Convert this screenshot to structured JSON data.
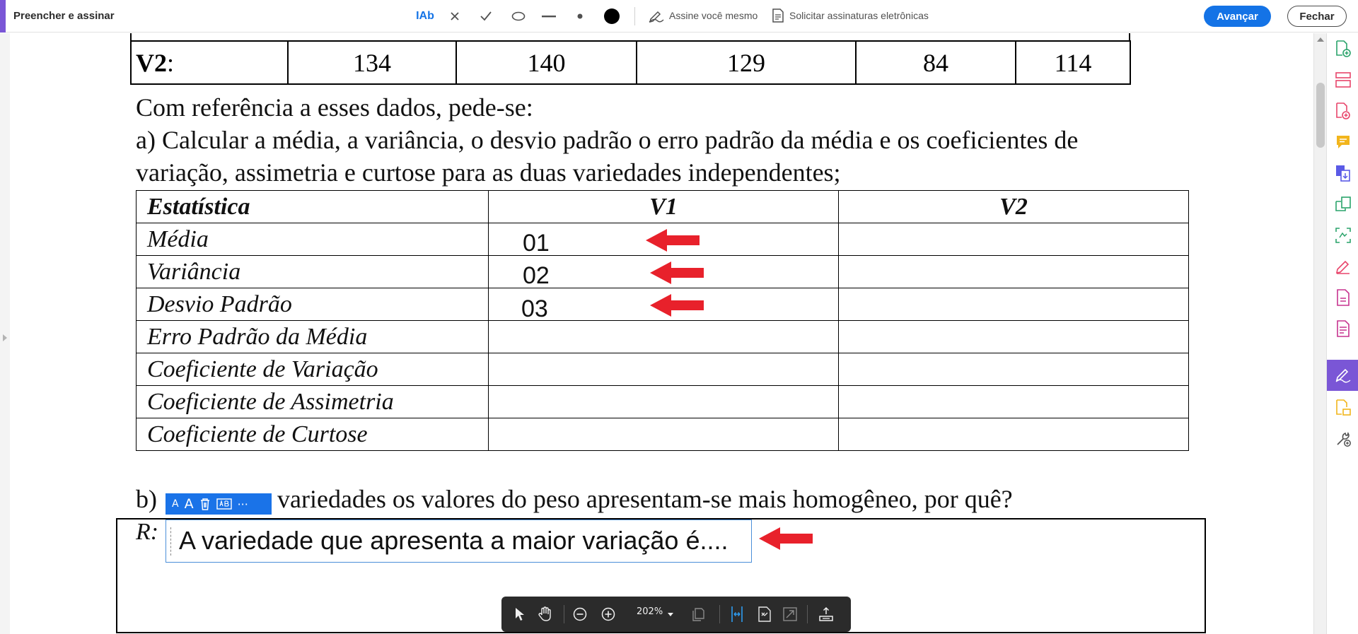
{
  "toolbar": {
    "title": "Preencher e assinar",
    "text_tool_label": "IAb",
    "sign_yourself": "Assine você mesmo",
    "request_signatures": "Solicitar assinaturas eletrônicas",
    "primary_button": "Avançar",
    "close_button": "Fechar",
    "accent_color": "#7a56d6",
    "primary_color": "#1473e6"
  },
  "document": {
    "v2_row": {
      "label_bold": "V2",
      "label_suffix": ":",
      "values": [
        "134",
        "140",
        "129",
        "84",
        "114"
      ]
    },
    "paragraph_1": "Com referência a esses dados, pede-se:",
    "paragraph_2": "a) Calcular a média, a variância, o desvio padrão o erro padrão da média e os coeficientes de",
    "paragraph_3": "variação, assimetria e curtose para as duas variedades independentes;",
    "stats_table": {
      "headers": [
        "Estatística",
        "V1",
        "V2"
      ],
      "rows": [
        {
          "label": "Média",
          "v1": "01",
          "v2": ""
        },
        {
          "label": "Variância",
          "v1": "02",
          "v2": ""
        },
        {
          "label": "Desvio Padrão",
          "v1": "03",
          "v2": ""
        },
        {
          "label": "Erro Padrão da Média",
          "v1": "",
          "v2": ""
        },
        {
          "label": "Coeficiente de Variação",
          "v1": "",
          "v2": ""
        },
        {
          "label": "Coeficiente de Assimetria",
          "v1": "",
          "v2": ""
        },
        {
          "label": "Coeficiente de Curtose",
          "v1": "",
          "v2": ""
        }
      ]
    },
    "question_b_prefix": "b)",
    "question_b_text": "variedades os valores do peso apresentam-se mais homogêneo, por quê?",
    "answer_label": "R:",
    "answer_field_value": "A variedade que apresenta a maior variação é....",
    "arrow_color": "#e8212b"
  },
  "field_toolbar": {
    "small_a": "A",
    "large_a": "A",
    "more": "···"
  },
  "float_toolbar": {
    "zoom": "202%"
  }
}
